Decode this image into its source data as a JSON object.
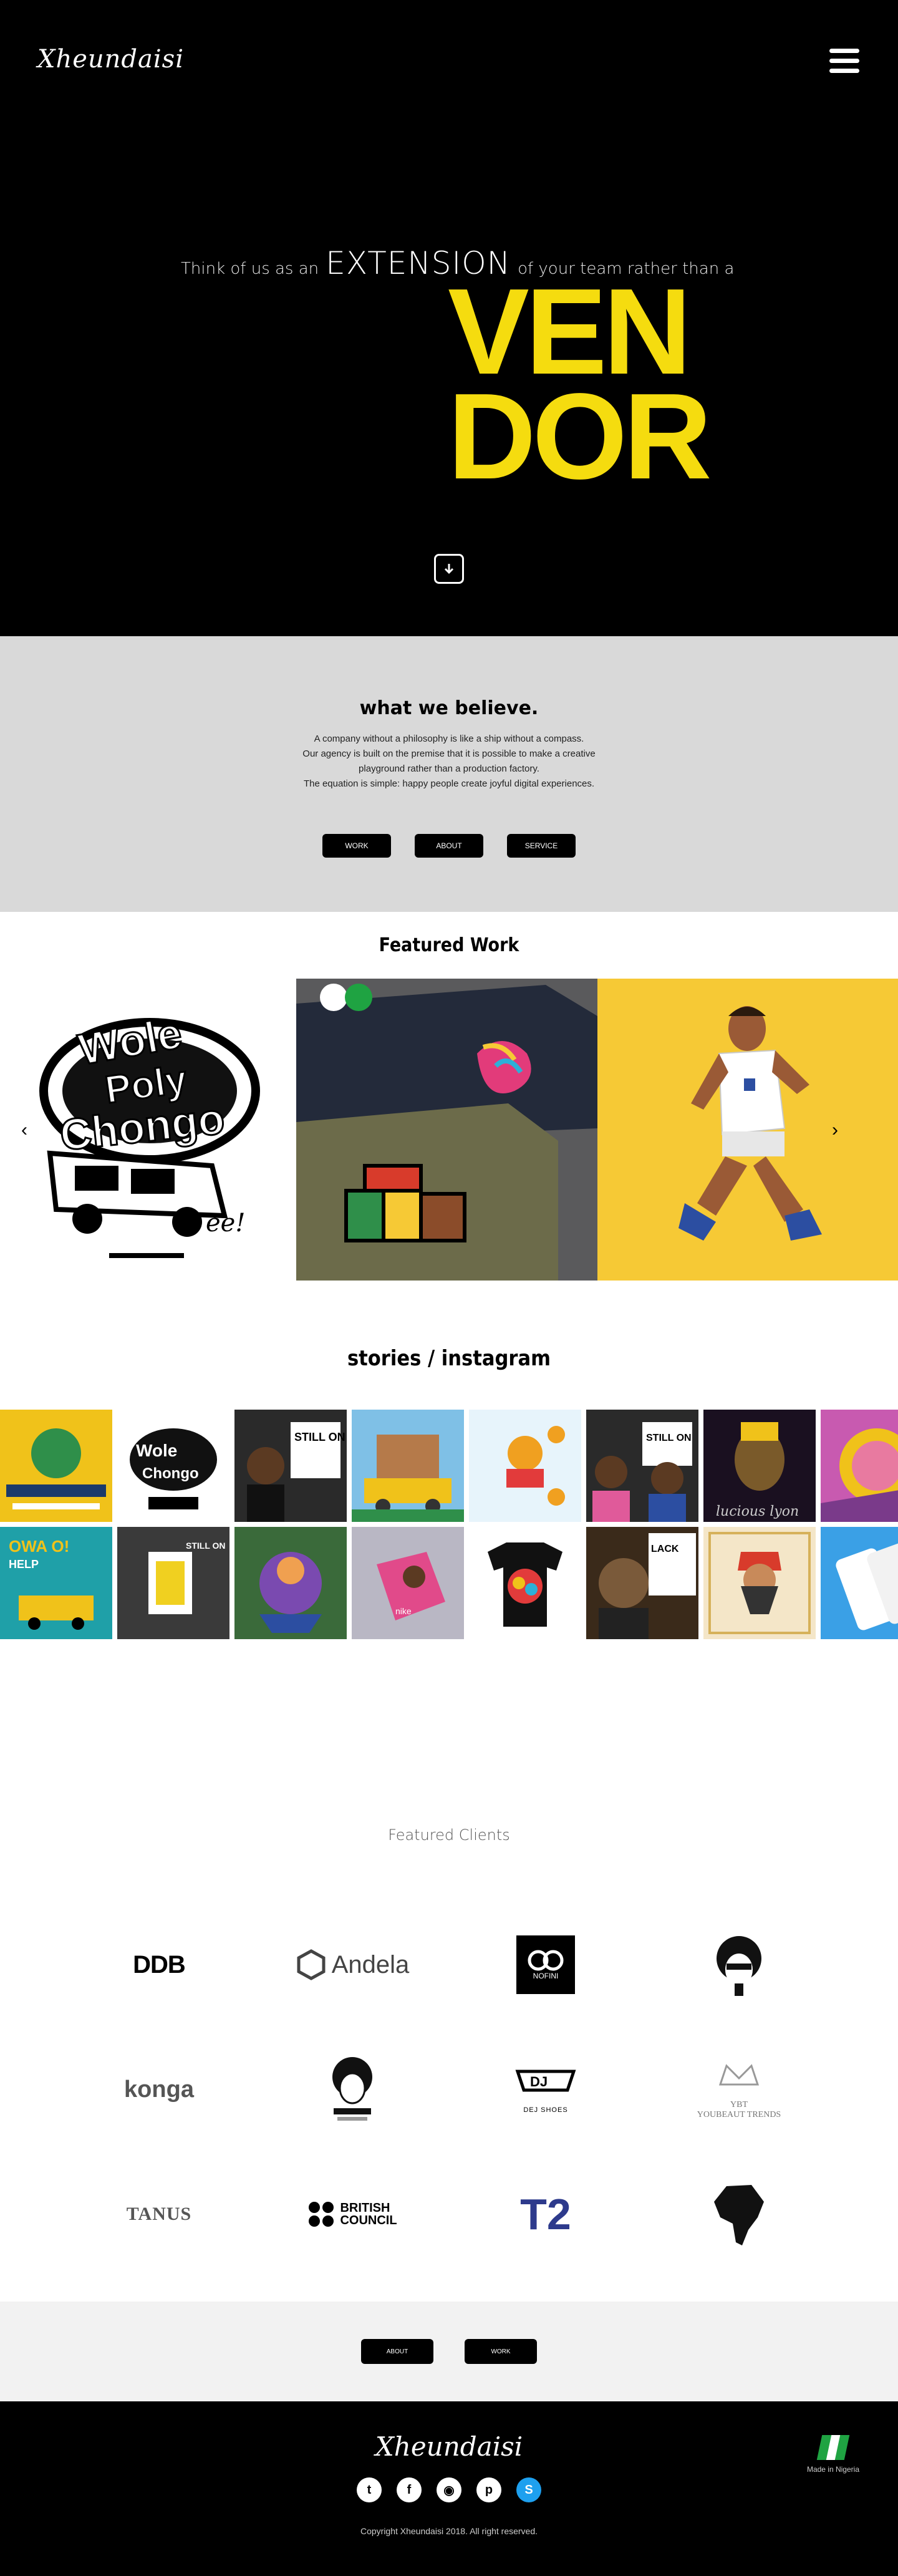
{
  "header": {
    "logo": "Xheundaisi",
    "menu_icon": "hamburger-menu-icon"
  },
  "hero": {
    "tag_prefix": "Think of us as an",
    "tag_highlight": "EXTENSION",
    "tag_suffix": "of your team rather than a",
    "headline_line1": "VEN",
    "headline_line2": "DOR",
    "scroll_icon": "arrow-down-icon",
    "accent": "#f5dc0f"
  },
  "believe": {
    "title": "what we believe.",
    "line1": "A company without a philosophy is like a ship without a compass.",
    "line2": "Our agency is built on the premise that it is possible to make a creative",
    "line3": "playground rather than a production factory.",
    "line4": "The equation is simple: happy people create joyful digital experiences.",
    "buttons": [
      "WORK",
      "ABOUT",
      "SERVICE"
    ]
  },
  "featured": {
    "title": "Featured Work",
    "prev_icon": "chevron-left-icon",
    "next_icon": "chevron-right-icon"
  },
  "stories": {
    "title": "stories / instagram"
  },
  "clients": {
    "title": "Featured Clients",
    "ddb": "DDB",
    "andela": "Andela",
    "nofini": "NOFINI",
    "konga": "konga",
    "dej": "DEJ SHOES",
    "ybt": "YBT",
    "ybt_sub": "YOUBEAUT TRENDS",
    "tanus": "TANUS",
    "british1": "BRITISH",
    "british2": "COUNCIL",
    "t2": "T2"
  },
  "bottom": {
    "about": "ABOUT",
    "work": "WORK"
  },
  "footer": {
    "logo": "Xheundaisi",
    "made_in": "Made in Nigeria",
    "copyright": "Copyright Xheundaisi 2018.  All right reserved."
  }
}
